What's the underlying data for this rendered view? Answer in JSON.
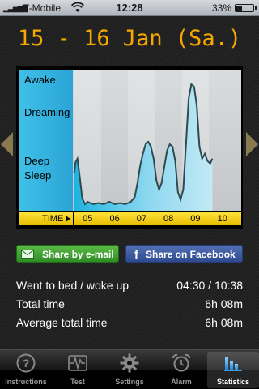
{
  "status_bar": {
    "carrier": "T-Mobile",
    "time": "12:28",
    "battery_percent": "33%",
    "battery_level": 0.33,
    "signal_icon": "signal-bars-icon",
    "wifi_icon": "wifi-icon"
  },
  "header": {
    "date_range": "15 - 16 Jan (Sa.)"
  },
  "nav": {
    "prev_icon": "chevron-left-icon",
    "next_icon": "chevron-right-icon"
  },
  "sleep_chart": {
    "y_labels": {
      "awake": "Awake",
      "dreaming": "Dreaming",
      "deep": "Deep",
      "sleep": "Sleep"
    },
    "time_label": "TIME",
    "hours": [
      "05",
      "06",
      "07",
      "08",
      "09",
      "10"
    ]
  },
  "chart_data": {
    "type": "area",
    "xlabel": "TIME",
    "ylabel": "",
    "categories": [
      "05",
      "06",
      "07",
      "08",
      "09",
      "10"
    ],
    "y_levels": [
      "Deep Sleep",
      "Dreaming",
      "Awake"
    ],
    "start_time": "04:30",
    "end_time": "10:38",
    "series": [
      {
        "values": [
          [
            4.5,
            0.26
          ],
          [
            4.55,
            0.35
          ],
          [
            4.62,
            0.38
          ],
          [
            4.7,
            0.24
          ],
          [
            4.8,
            0.05
          ],
          [
            4.9,
            0.0
          ],
          [
            5.0,
            0.02
          ],
          [
            5.2,
            0.0
          ],
          [
            5.4,
            0.01
          ],
          [
            5.6,
            0.0
          ],
          [
            5.8,
            0.02
          ],
          [
            6.0,
            0.0
          ],
          [
            6.2,
            0.01
          ],
          [
            6.4,
            0.0
          ],
          [
            6.6,
            0.02
          ],
          [
            6.75,
            0.06
          ],
          [
            6.85,
            0.18
          ],
          [
            6.95,
            0.32
          ],
          [
            7.05,
            0.42
          ],
          [
            7.15,
            0.5
          ],
          [
            7.25,
            0.52
          ],
          [
            7.35,
            0.48
          ],
          [
            7.45,
            0.38
          ],
          [
            7.55,
            0.2
          ],
          [
            7.65,
            0.12
          ],
          [
            7.75,
            0.18
          ],
          [
            7.85,
            0.32
          ],
          [
            7.95,
            0.45
          ],
          [
            8.05,
            0.5
          ],
          [
            8.15,
            0.48
          ],
          [
            8.25,
            0.36
          ],
          [
            8.35,
            0.1
          ],
          [
            8.45,
            0.04
          ],
          [
            8.55,
            0.12
          ],
          [
            8.65,
            0.5
          ],
          [
            8.75,
            0.88
          ],
          [
            8.85,
            1.0
          ],
          [
            8.95,
            0.98
          ],
          [
            9.05,
            0.82
          ],
          [
            9.15,
            0.48
          ],
          [
            9.25,
            0.38
          ],
          [
            9.35,
            0.42
          ],
          [
            9.45,
            0.36
          ],
          [
            9.55,
            0.34
          ],
          [
            9.63,
            0.38
          ]
        ]
      }
    ]
  },
  "share": {
    "email_label": "Share by e-mail",
    "email_icon": "envelope-icon",
    "facebook_label": "Share on Facebook",
    "facebook_icon": "facebook-icon"
  },
  "stats": {
    "bed_wake_label": "Went to bed / woke up",
    "bed_wake_value": "04:30 / 10:38",
    "total_label": "Total time",
    "total_value": "6h 08m",
    "avg_label": "Average total time",
    "avg_value": "6h 08m"
  },
  "tabs": [
    {
      "label": "Instructions",
      "icon": "question-icon",
      "active": false
    },
    {
      "label": "Test",
      "icon": "waveform-icon",
      "active": false
    },
    {
      "label": "Settings",
      "icon": "gear-icon",
      "active": false
    },
    {
      "label": "Alarm",
      "icon": "alarm-clock-icon",
      "active": false
    },
    {
      "label": "Statistics",
      "icon": "bar-chart-icon",
      "active": true
    }
  ],
  "colors": {
    "title": "#f5a800",
    "label_panel": "#3fc0e8",
    "time_bar": "#ffe23a",
    "curve": "#2d4a52",
    "fill": "#bfc4c7",
    "email_button": "#3f9c2f",
    "facebook_button": "#3b5998"
  }
}
